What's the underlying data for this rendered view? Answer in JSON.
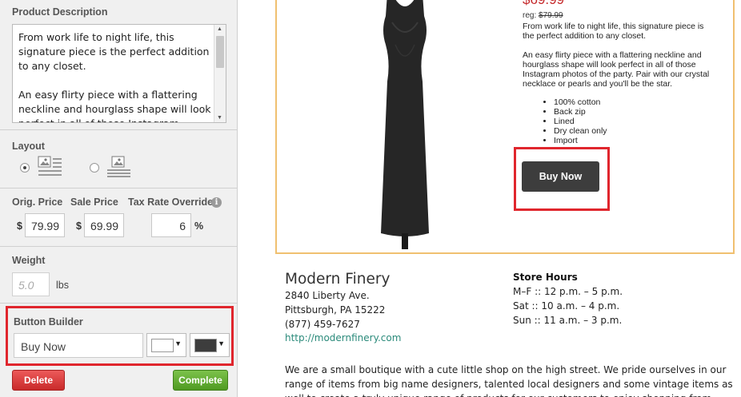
{
  "editor": {
    "description": {
      "label": "Product Description",
      "text": "From work life to night life, this signature piece is the perfect addition to any closet.\n\nAn easy flirty piece with a flattering neckline and hourglass shape will look perfect in all of those Instagram photos of the party."
    },
    "layout": {
      "label": "Layout",
      "selected": "image-left"
    },
    "pricing": {
      "orig_label": "Orig. Price",
      "sale_label": "Sale Price",
      "tax_label": "Tax Rate Override",
      "currency": "$",
      "orig_value": "79.99",
      "sale_value": "69.99",
      "tax_value": "6",
      "percent": "%"
    },
    "weight": {
      "label": "Weight",
      "placeholder": "5.0",
      "unit": "lbs"
    },
    "button_builder": {
      "label": "Button Builder",
      "text_value": "Buy Now",
      "text_color": "#ffffff",
      "bg_color": "#3d3d3d"
    },
    "actions": {
      "delete_label": "Delete",
      "complete_label": "Complete"
    }
  },
  "preview": {
    "product": {
      "price": "$69.99",
      "reg_prefix": "reg:",
      "reg_price": "$79.99",
      "para1": "From work life to night life, this signature piece is the perfect addition to any closet.",
      "para2": "An easy flirty piece with a flattering neckline and hourglass shape will look perfect in all of those Instagram photos of the party.  Pair with our crystal necklace or pearls and you'll be the star.",
      "features": [
        "100% cotton",
        "Back zip",
        "Lined",
        "Dry clean only",
        "Import"
      ],
      "buy_label": "Buy Now"
    },
    "store": {
      "name": "Modern Finery",
      "address1": "2840 Liberty Ave.",
      "address2": "Pittsburgh, PA 15222",
      "phone": "(877) 459-7627",
      "url": "http://modernfinery.com",
      "hours_title": "Store Hours",
      "hours": [
        "M–F :: 12 p.m. – 5 p.m.",
        "Sat :: 10 a.m. – 4 p.m.",
        "Sun :: 11 a.m. – 3 p.m."
      ],
      "about": "We are a small boutique with a cute little shop on the high street. We pride ourselves in our range of items from big name designers, talented local designers and some vintage items as well to create a truly unique range of products for our customers to enjoy shopping from."
    }
  },
  "colors": {
    "highlight": "#e0262d",
    "price": "#c4282a",
    "link": "#2a8a7a",
    "delete": "#d63b3b",
    "complete": "#5fa92e"
  },
  "icons": [
    "info-icon",
    "layout-image-left-icon",
    "layout-image-top-icon",
    "scroll-up-arrow-icon",
    "scroll-down-arrow-icon",
    "dropdown-caret-icon"
  ]
}
